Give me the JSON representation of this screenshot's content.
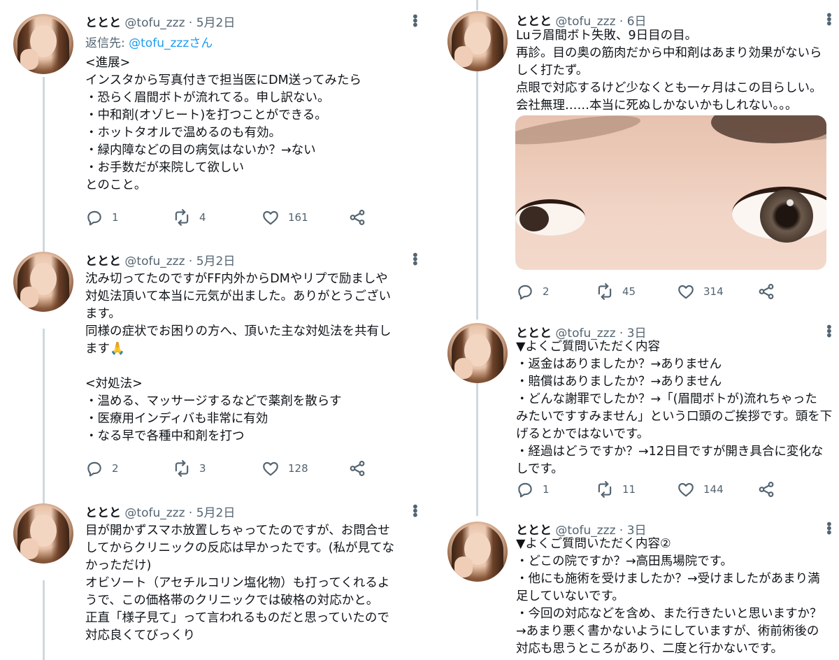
{
  "user": {
    "name": "ととと",
    "handle": "@tofu_zzz"
  },
  "left": [
    {
      "time": "5月2日",
      "reply_prefix": "返信先: ",
      "reply_user": "@tofu_zzzさん",
      "lines": [
        "<進展>",
        "インスタから写真付きで担当医にDM送ってみたら",
        "・恐らく眉間ボトが流れてる。申し訳ない。",
        "・中和剤(オゾヒート)を打つことができる。",
        "・ホットタオルで温めるのも有効。",
        "・緑内障などの目の病気はないか？→ない",
        "・お手数だが来院して欲しい",
        "とのこと。"
      ],
      "replies": "1",
      "retweets": "4",
      "likes": "161"
    },
    {
      "time": "5月2日",
      "lines": [
        "沈み切ってたのですがFF内外からDMやリプで励ましや",
        "対処法頂いて本当に元気が出ました。ありがとうござい",
        "ます。",
        "同様の症状でお困りの方へ、頂いた主な対処法を共有し",
        "ます🙏",
        "",
        "<対処法>",
        "・温める、マッサージするなどで薬剤を散らす",
        "・医療用インディバも非常に有効",
        "・なる早で各種中和剤を打つ"
      ],
      "replies": "2",
      "retweets": "3",
      "likes": "128"
    },
    {
      "time": "5月2日",
      "lines": [
        "目が開かずスマホ放置しちゃってたのですが、お問合せ",
        "してからクリニックの反応は早かったです。(私が見てな",
        "かっただけ)",
        "オビソート（アセチルコリン塩化物）も打ってくれるよ",
        "うで、この価格帯のクリニックでは破格の対応かと。",
        "正直「様子見て」って言われるものだと思っていたので",
        "対応良くてびっくり"
      ]
    }
  ],
  "right": [
    {
      "time": "6日",
      "lines": [
        "Luラ眉間ボト失敗、9日目の目。",
        "再診。目の奥の筋肉だから中和剤はあまり効果がないら",
        "しく打たず。",
        "点眼で対応するけど少なくとも一ヶ月はこの目らしい。",
        "会社無理……本当に死ぬしかないかもしれない。。。"
      ],
      "replies": "2",
      "retweets": "45",
      "likes": "314"
    },
    {
      "time": "3日",
      "lines": [
        "▼よくご質問いただく内容",
        "・返金はありましたか？→ありません",
        "・賠償はありましたか？→ありません",
        "・どんな謝罪でしたか？→「(眉間ボトが)流れちゃった",
        "みたいですすみません」という口頭のご挨拶です。頭を下",
        "げるとかではないです。",
        "・経過はどうですか？→12日目ですが開き具合に変化な",
        "しです。"
      ],
      "replies": "1",
      "retweets": "11",
      "likes": "144"
    },
    {
      "time": "3日",
      "lines": [
        "▼よくご質問いただく内容②",
        "・どこの院ですか？→高田馬場院です。",
        "・他にも施術を受けましたか？→受けましたがあまり満",
        "足していないです。",
        "・今回の対応などを含め、また行きたいと思いますか？",
        "→あまり悪く書かないようにしていますが、術前術後の",
        "対応も思うところがあり、二度と行かないです。"
      ]
    }
  ]
}
